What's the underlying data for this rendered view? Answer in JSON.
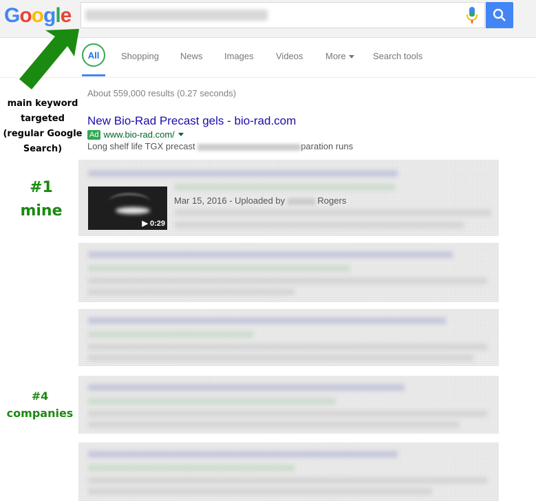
{
  "logo": {
    "letters": [
      "G",
      "o",
      "o",
      "g",
      "l",
      "e"
    ]
  },
  "colors": {
    "blue": "#4285f4",
    "red": "#ea4335",
    "yellow": "#fbbc05",
    "green": "#34a853",
    "link": "#1a0dab",
    "url": "#006621",
    "annotation": "#1b8a10"
  },
  "search": {
    "mic_icon": "mic-icon",
    "button_icon": "search-icon"
  },
  "tabs": {
    "items": [
      {
        "label": "All",
        "active": true
      },
      {
        "label": "Shopping"
      },
      {
        "label": "News"
      },
      {
        "label": "Images"
      },
      {
        "label": "Videos"
      },
      {
        "label": "More"
      },
      {
        "label": "Search tools"
      }
    ]
  },
  "results": {
    "stats": "About 559,000 results (0.27 seconds)",
    "ad": {
      "title": "New Bio-Rad Precast gels - bio-rad.com",
      "badge": "Ad",
      "url": "www.bio-rad.com/",
      "desc_start": "Long shelf life TGX precast",
      "desc_end": "paration runs"
    },
    "video": {
      "duration": "0:29",
      "date_text": "Mar 15, 2016 - Uploaded by",
      "uploader_suffix": "Rogers"
    }
  },
  "annotations": {
    "main_keyword": [
      "main keyword",
      "targeted",
      "(regular Google",
      "Search)"
    ],
    "rank1": [
      "#1",
      "mine"
    ],
    "rank4": [
      "#4",
      "companies"
    ]
  }
}
